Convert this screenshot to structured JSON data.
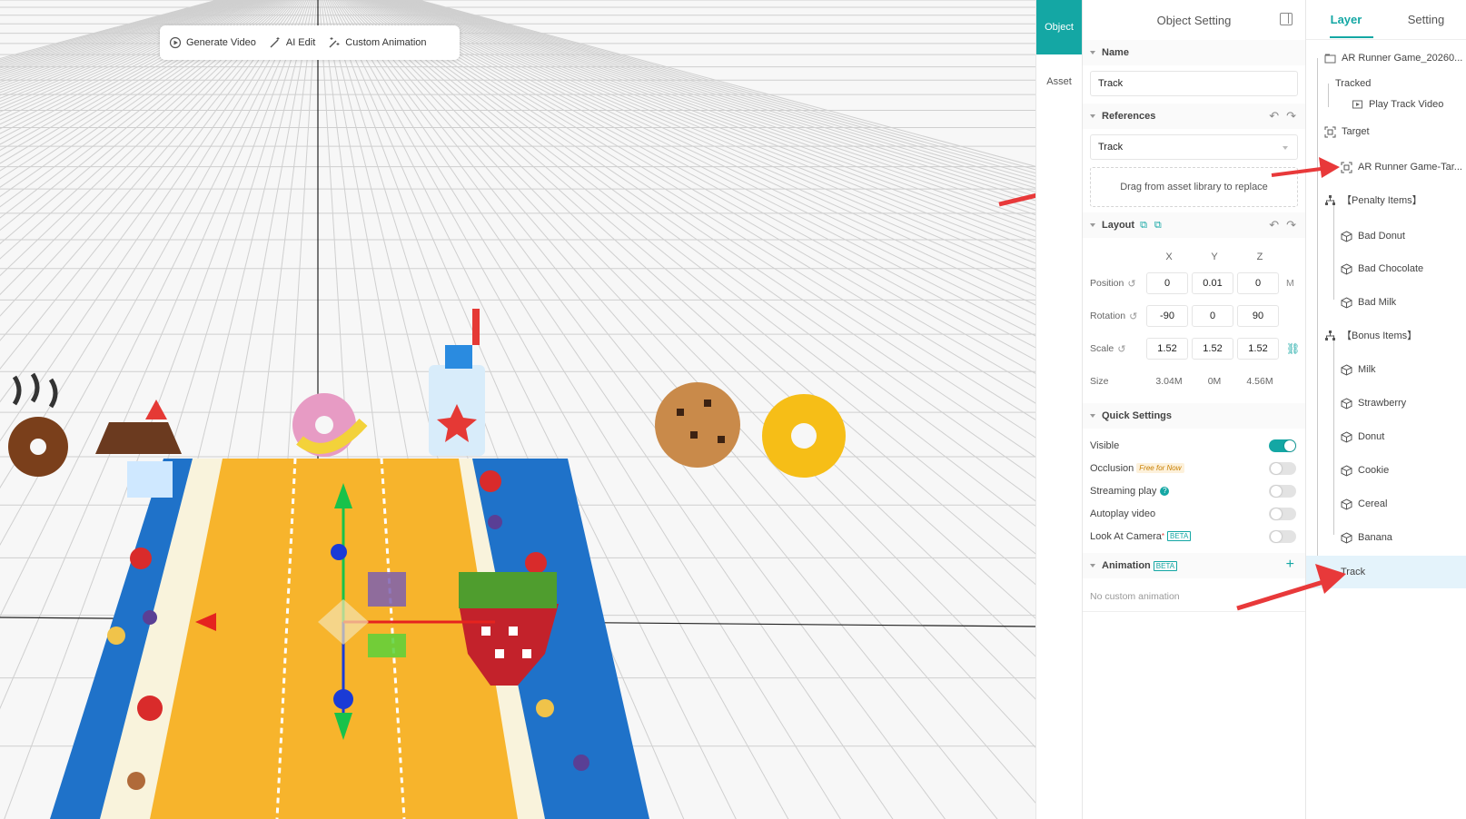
{
  "toolbar": {
    "generate_video": "Generate Video",
    "ai_edit": "AI Edit",
    "custom_animation": "Custom Animation"
  },
  "side_tabs": {
    "object": "Object",
    "asset": "Asset"
  },
  "props": {
    "title": "Object Setting",
    "name_section": "Name",
    "name_value": "Track",
    "references_section": "References",
    "reference_value": "Track",
    "drop_hint": "Drag from asset library to replace",
    "layout_section": "Layout",
    "axis_x": "X",
    "axis_y": "Y",
    "axis_z": "Z",
    "position_label": "Position",
    "position": {
      "x": "0",
      "y": "0.01",
      "z": "0"
    },
    "position_unit": "M",
    "rotation_label": "Rotation",
    "rotation": {
      "x": "-90",
      "y": "0",
      "z": "90"
    },
    "scale_label": "Scale",
    "scale": {
      "x": "1.52",
      "y": "1.52",
      "z": "1.52"
    },
    "size_label": "Size",
    "size": {
      "x": "3.04M",
      "y": "0M",
      "z": "4.56M"
    },
    "quick_settings_section": "Quick Settings",
    "visible_label": "Visible",
    "occlusion_label": "Occlusion",
    "occlusion_badge": "Free for Now",
    "streaming_label": "Streaming play",
    "autoplay_label": "Autoplay video",
    "look_at_camera_label": "Look At Camera",
    "beta_badge": "BETA",
    "animation_section": "Animation",
    "animation_badge": "BETA",
    "no_animation": "No custom animation",
    "toggles": {
      "visible": true,
      "occlusion": false,
      "streaming": false,
      "autoplay": false,
      "look_at_camera": false
    }
  },
  "layers": {
    "tab_layer": "Layer",
    "tab_setting": "Setting",
    "items": {
      "root": "AR Runner Game_20260...",
      "tracked": "Tracked",
      "play_track_video": "Play Track Video",
      "target": "Target",
      "target_image": "AR Runner Game-Tar...",
      "penalty_group": "【Penalty Items】",
      "bad_donut": "Bad Donut",
      "bad_chocolate": "Bad Chocolate",
      "bad_milk": "Bad Milk",
      "bonus_group": "【Bonus Items】",
      "milk": "Milk",
      "strawberry": "Strawberry",
      "donut": "Donut",
      "cookie": "Cookie",
      "cereal": "Cereal",
      "banana": "Banana",
      "track": "Track"
    }
  },
  "colors": {
    "accent": "#14a7a4",
    "arrow_red": "#e8393a",
    "selected_bg": "#e4f3fb"
  },
  "icons": {
    "generate_video": "play-circle-icon",
    "ai_edit": "magic-wand-icon",
    "custom_animation": "sparkle-wand-icon",
    "group": "hierarchy-icon",
    "model": "cube-icon",
    "target": "target-frame-icon"
  }
}
